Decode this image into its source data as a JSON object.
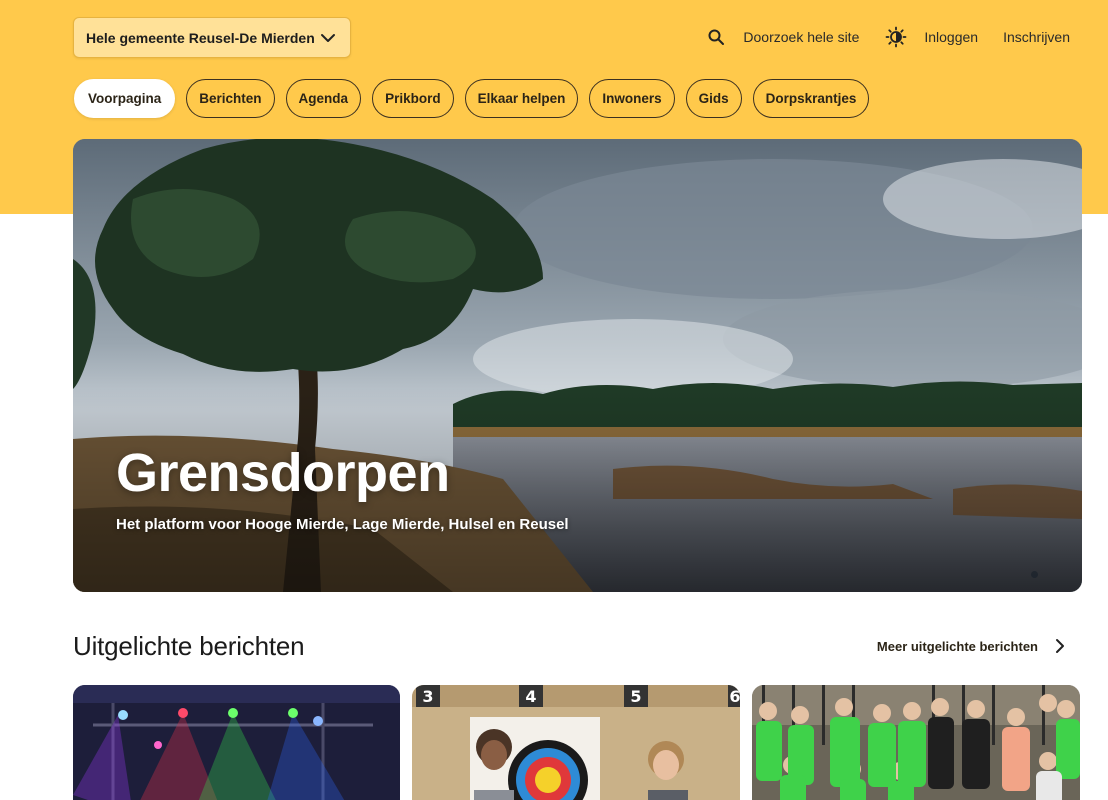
{
  "header": {
    "region_select": "Hele gemeente Reusel-De Mierden",
    "search_label": "Doorzoek hele site",
    "login": "Inloggen",
    "register": "Inschrijven"
  },
  "nav": {
    "items": [
      {
        "label": "Voorpagina",
        "active": true
      },
      {
        "label": "Berichten"
      },
      {
        "label": "Agenda"
      },
      {
        "label": "Prikbord"
      },
      {
        "label": "Elkaar helpen"
      },
      {
        "label": "Inwoners"
      },
      {
        "label": "Gids"
      },
      {
        "label": "Dorpskrantjes"
      }
    ]
  },
  "hero": {
    "title": "Grensdorpen",
    "subtitle": "Het platform voor Hooge Mierde, Lage Mierde, Hulsel en Reusel"
  },
  "featured": {
    "title": "Uitgelichte berichten",
    "more_link": "Meer uitgelichte berichten",
    "card2_numbers": [
      "3",
      "4",
      "5",
      "6"
    ]
  },
  "colors": {
    "brand_yellow": "#ffc94b",
    "select_bg": "#ffe198"
  }
}
